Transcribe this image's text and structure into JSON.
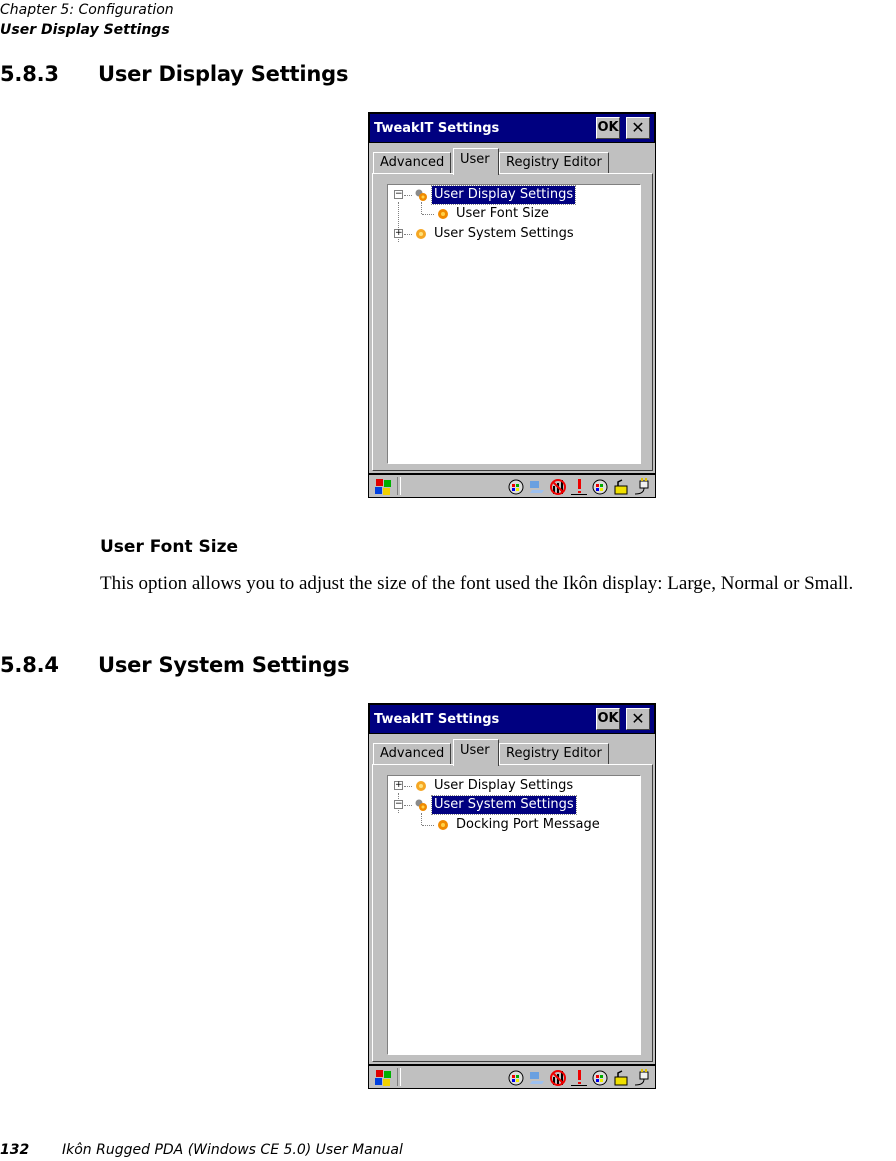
{
  "running_head": {
    "chapter": "Chapter 5:  Configuration",
    "section": "User Display Settings"
  },
  "sections": [
    {
      "number": "5.8.3",
      "title": "User Display Settings",
      "screenshot": {
        "window_title": "TweakIT Settings",
        "ok_label": "OK",
        "close_glyph": "✕",
        "tabs": [
          {
            "label": "Advanced",
            "active": false
          },
          {
            "label": "User",
            "active": true
          },
          {
            "label": "Registry Editor",
            "active": false
          }
        ],
        "tree": [
          {
            "label": "User Display Settings",
            "expander": "−",
            "selected": true,
            "level": 0,
            "icon": "gears-icon"
          },
          {
            "label": "User Font Size",
            "expander": "",
            "selected": false,
            "level": 1,
            "icon": "gear-icon"
          },
          {
            "label": "User System Settings",
            "expander": "+",
            "selected": false,
            "level": 0,
            "icon": "gear-icon"
          }
        ],
        "taskbar": {
          "start_icon": "windows-flag-icon",
          "tray_icons": [
            "network-icon",
            "connection-icon",
            "no-signal-icon",
            "alert-icon",
            "network-icon",
            "keyboard-lock-icon",
            "power-plug-icon"
          ]
        }
      },
      "subsections": [
        {
          "title": "User Font Size",
          "body": "This option allows you to adjust the size of the font used the Ikôn display: Large, Normal or Small."
        }
      ]
    },
    {
      "number": "5.8.4",
      "title": "User System Settings",
      "screenshot": {
        "window_title": "TweakIT Settings",
        "ok_label": "OK",
        "close_glyph": "✕",
        "tabs": [
          {
            "label": "Advanced",
            "active": false
          },
          {
            "label": "User",
            "active": true
          },
          {
            "label": "Registry Editor",
            "active": false
          }
        ],
        "tree": [
          {
            "label": "User Display Settings",
            "expander": "+",
            "selected": false,
            "level": 0,
            "icon": "gear-icon"
          },
          {
            "label": "User System Settings",
            "expander": "−",
            "selected": true,
            "level": 0,
            "icon": "gears-icon"
          },
          {
            "label": "Docking Port Message",
            "expander": "",
            "selected": false,
            "level": 1,
            "icon": "gear-icon"
          }
        ],
        "taskbar": {
          "start_icon": "windows-flag-icon",
          "tray_icons": [
            "network-icon",
            "connection-icon",
            "no-signal-icon",
            "alert-icon",
            "network-icon",
            "keyboard-lock-icon",
            "power-plug-icon"
          ]
        }
      }
    }
  ],
  "footer": {
    "page_number": "132",
    "manual_title": "Ikôn Rugged PDA (Windows CE 5.0) User Manual"
  }
}
